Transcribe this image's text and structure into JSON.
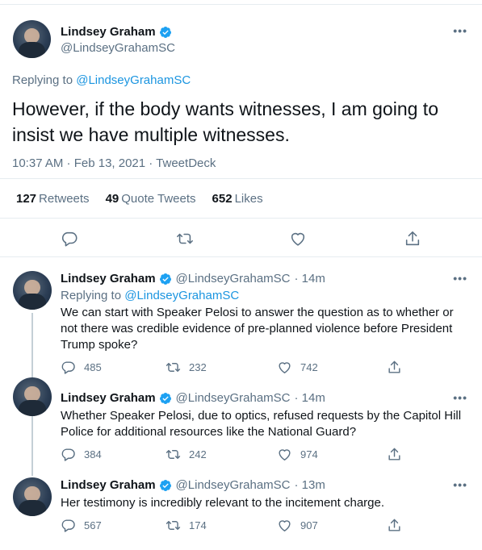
{
  "main_tweet": {
    "name": "Lindsey Graham",
    "handle": "@LindseyGrahamSC",
    "replying_prefix": "Replying to",
    "replying_to": "@LindseyGrahamSC",
    "text": "However, if the body wants witnesses, I am going to insist we have multiple witnesses.",
    "meta": "10:37 AM · Feb 13, 2021 · TweetDeck",
    "stats": {
      "retweets_count": "127",
      "retweets_label": "Retweets",
      "quotes_count": "49",
      "quotes_label": "Quote Tweets",
      "likes_count": "652",
      "likes_label": "Likes"
    }
  },
  "replies": [
    {
      "name": "Lindsey Graham",
      "handle": "@LindseyGrahamSC",
      "time": "· 14m",
      "replying_prefix": "Replying to",
      "replying_to": "@LindseyGrahamSC",
      "text": "We can start with Speaker Pelosi to answer the question as to whether or not there was credible evidence of pre-planned violence before President Trump spoke?",
      "replies": "485",
      "retweets": "232",
      "likes": "742"
    },
    {
      "name": "Lindsey Graham",
      "handle": "@LindseyGrahamSC",
      "time": "· 14m",
      "text": "Whether Speaker Pelosi, due to optics, refused requests by the Capitol Hill Police for additional resources like the National Guard?",
      "replies": "384",
      "retweets": "242",
      "likes": "974"
    },
    {
      "name": "Lindsey Graham",
      "handle": "@LindseyGrahamSC",
      "time": "· 13m",
      "text": "Her testimony is incredibly relevant to the incitement charge.",
      "replies": "567",
      "retweets": "174",
      "likes": "907"
    }
  ],
  "more_glyph": "•••",
  "colors": {
    "accent": "#1da1f2",
    "muted": "#5b7083",
    "text": "#0f1419",
    "border": "#e6ecf0"
  }
}
